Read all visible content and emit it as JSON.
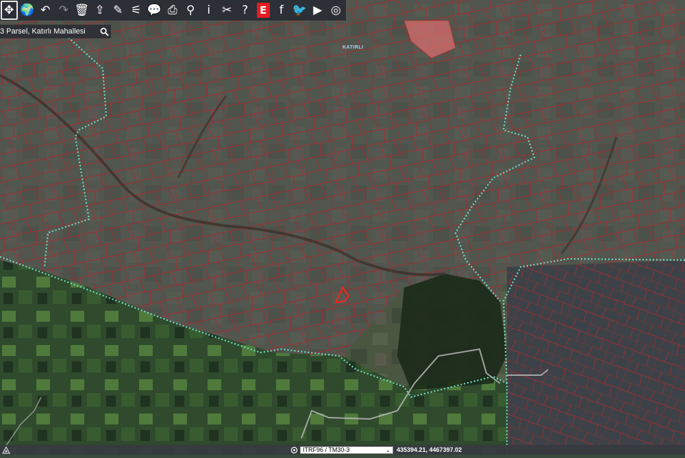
{
  "toolbar": {
    "buttons": [
      {
        "name": "pan-button",
        "icon": "move-arrows-icon",
        "glyph": "✥",
        "active": true
      },
      {
        "name": "basemap-button",
        "icon": "globe-icon",
        "glyph": "🌍"
      },
      {
        "name": "undo-button",
        "icon": "undo-icon",
        "glyph": "↶"
      },
      {
        "name": "redo-button",
        "icon": "redo-icon",
        "glyph": "↷",
        "disabled": true
      },
      {
        "name": "clear-button",
        "icon": "trash-icon",
        "glyph": "🗑"
      },
      {
        "name": "share-button",
        "icon": "share-icon",
        "glyph": "⇪"
      },
      {
        "name": "draw-button",
        "icon": "pencil-icon",
        "glyph": "✎"
      },
      {
        "name": "measure-button",
        "icon": "measure-icon",
        "glyph": "⚟"
      },
      {
        "name": "feedback-button",
        "icon": "speech-bubble-icon",
        "glyph": "💬"
      },
      {
        "name": "print-button",
        "icon": "printer-icon",
        "glyph": "⎙"
      },
      {
        "name": "location-button",
        "icon": "map-pin-icon",
        "glyph": "⚲"
      },
      {
        "name": "info-button",
        "icon": "info-icon",
        "glyph": "i"
      },
      {
        "name": "tools-button",
        "icon": "tools-icon",
        "glyph": "✂"
      },
      {
        "name": "help-button",
        "icon": "question-icon",
        "glyph": "?"
      },
      {
        "name": "edevlet-button",
        "icon": "e-logo-icon",
        "glyph": "E"
      },
      {
        "name": "facebook-button",
        "icon": "facebook-icon",
        "glyph": "f"
      },
      {
        "name": "twitter-button",
        "icon": "twitter-icon",
        "glyph": "🐦"
      },
      {
        "name": "youtube-button",
        "icon": "youtube-icon",
        "glyph": "▶"
      },
      {
        "name": "instagram-button",
        "icon": "instagram-icon",
        "glyph": "◎"
      }
    ]
  },
  "search": {
    "value": "3 Parsel, Katırlı Mahallesi",
    "icon": "search-icon"
  },
  "map": {
    "place_label": "KATIRLI",
    "colors": {
      "parcel_lines": "#b4262a",
      "selected_parcel": "#ff2020",
      "boundary_dotted": "#6fe0c8",
      "highlight_fill": "#e07070",
      "road": "#b8b8b8"
    }
  },
  "status": {
    "layers_icon": "layers-icon",
    "target_icon": "crosshair-icon",
    "crs_selected": "ITRF96 / TM30-3",
    "coordinates": "435394.21, 4467397.02"
  },
  "colors": {
    "toolbar_bg": "#282c34",
    "statusbar_bg": "#373a40"
  }
}
